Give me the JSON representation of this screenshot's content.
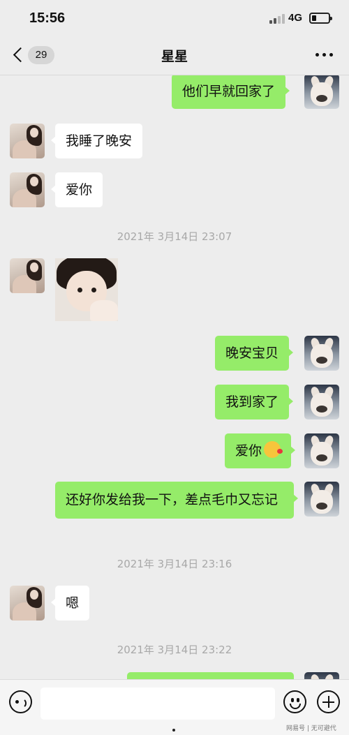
{
  "status_bar": {
    "time": "15:56",
    "network": "4G"
  },
  "header": {
    "back_count": "29",
    "title": "星星"
  },
  "timestamps": [
    "2021年 3月14日 23:07",
    "2021年 3月14日 23:16",
    "2021年 3月14日 23:22"
  ],
  "messages": [
    {
      "from": "me",
      "text": "他们早就回家了"
    },
    {
      "from": "contact",
      "text": "我睡了晚安"
    },
    {
      "from": "contact",
      "text": "爱你"
    },
    {
      "from": "contact",
      "type": "image",
      "image": "toddler-photo"
    },
    {
      "from": "me",
      "text": "晚安宝贝"
    },
    {
      "from": "me",
      "text": "我到家了"
    },
    {
      "from": "me",
      "text": "爱你",
      "emoji": "kissing-face-emoji"
    },
    {
      "from": "me",
      "text": "还好你发给我一下，差点毛巾又忘记"
    },
    {
      "from": "contact",
      "text": "嗯"
    }
  ],
  "input": {
    "placeholder": ""
  },
  "watermark": "网易号 | 无可避代",
  "colors": {
    "sent_bubble": "#95ec69",
    "received_bubble": "#ffffff",
    "background": "#ededed"
  }
}
